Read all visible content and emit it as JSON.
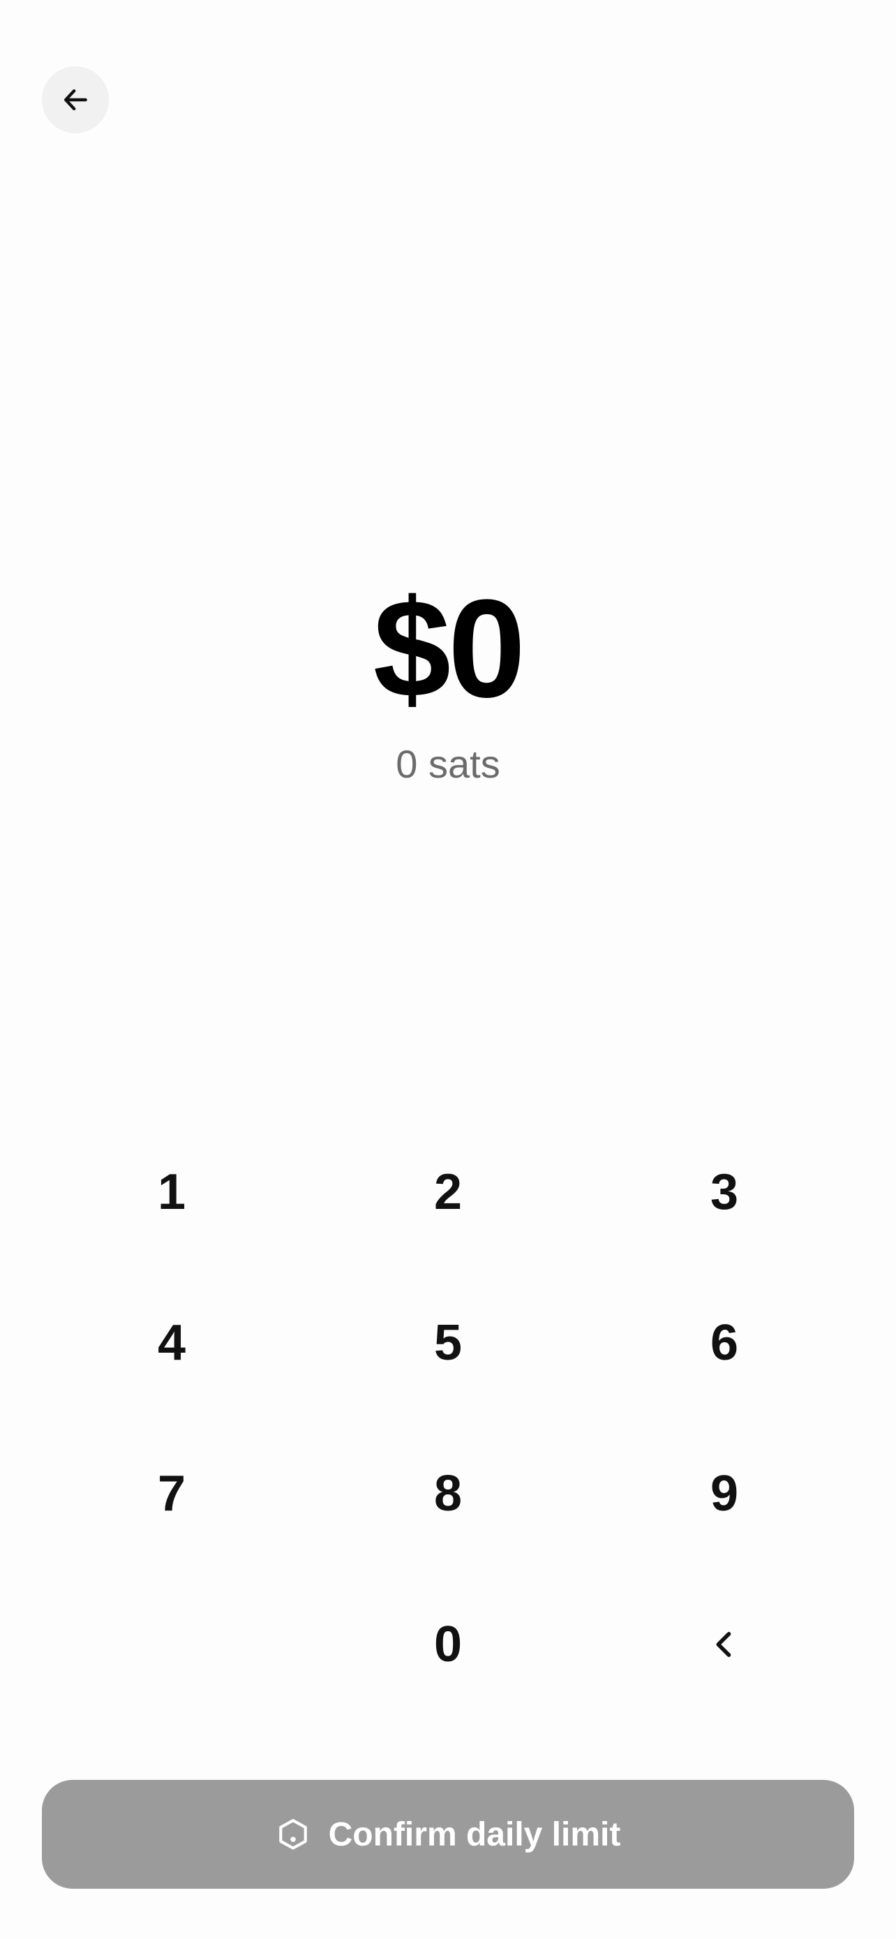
{
  "header": {
    "back_icon": "arrow-left-icon"
  },
  "amount": {
    "fiat": "$0",
    "sats": "0 sats"
  },
  "keypad": {
    "keys": [
      "1",
      "2",
      "3",
      "4",
      "5",
      "6",
      "7",
      "8",
      "9",
      "",
      "0",
      "<"
    ],
    "backspace_icon": "chevron-left-icon"
  },
  "footer": {
    "confirm_label": "Confirm daily limit",
    "confirm_icon": "hexagon-icon",
    "confirm_bg": "#9b9b9b"
  }
}
